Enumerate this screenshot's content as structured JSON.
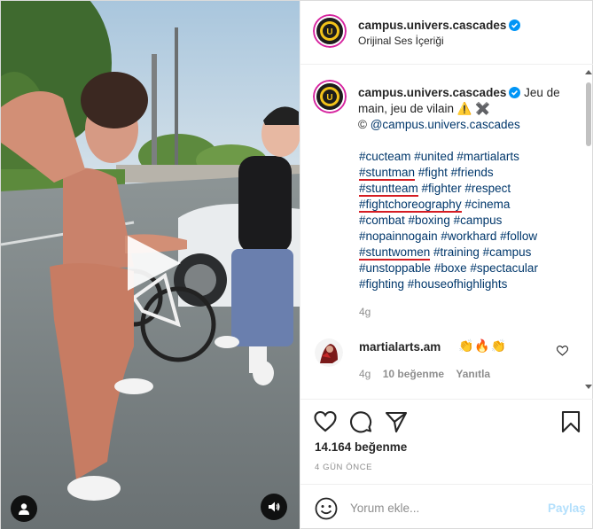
{
  "post": {
    "account": "campus.univers.cascades",
    "audio_label": "Orijinal Ses İçeriği",
    "caption": {
      "username": "campus.univers.cascades",
      "text": "Jeu de main, jeu de vilain ⚠️ ✖️",
      "mention_prefix": "© ",
      "mention": "@campus.univers.cascades",
      "hashtags": [
        "#cucteam",
        "#united",
        "#martialarts",
        "#stuntman",
        "#fight",
        "#friends",
        "#stuntteam",
        "#fighter",
        "#respect",
        "#fightchoreography",
        "#cinema",
        "#combat",
        "#boxing",
        "#campus",
        "#nopainnogain",
        "#workhard",
        "#follow",
        "#stuntwomen",
        "#training",
        "#campus",
        "#unstoppable",
        "#boxe",
        "#spectacular",
        "#fighting",
        "#houseofhighlights"
      ],
      "time": "4g"
    },
    "comment": {
      "username": "martialarts.am",
      "text": "👏🔥👏",
      "time": "4g",
      "likes": "10 beğenme",
      "reply": "Yanıtla"
    },
    "likes_text": "14.164 beğenme",
    "posted_ago": "4 GÜN ÖNCE",
    "comment_placeholder": "Yorum ekle...",
    "post_button": "Paylaş",
    "icons": [
      "play-icon",
      "user-tag-icon",
      "sound-icon",
      "verified-icon",
      "heart-icon",
      "comment-icon",
      "share-icon",
      "bookmark-icon",
      "emoji-icon"
    ],
    "colors": {
      "link": "#00376b",
      "verified": "#0095f6",
      "muted": "#8e8e8e",
      "annotation_underline": "#d51c22",
      "post_button_disabled": "#b2dffc"
    }
  }
}
